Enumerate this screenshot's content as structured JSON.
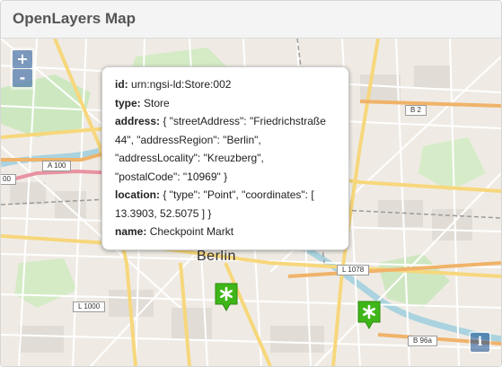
{
  "header": {
    "title": "OpenLayers Map"
  },
  "map": {
    "zoom_in_label": "+",
    "zoom_out_label": "-",
    "attribution_label": "i",
    "city_label": "Berlin",
    "road_labels": {
      "a100": "A 100",
      "b2": "B 2",
      "l1078": "L 1078",
      "l1000": "L 1000",
      "b96a": "B 96a",
      "edge_left": "00"
    },
    "markers": [
      {
        "icon": "asterisk-marker-icon",
        "color": "#3fb618"
      },
      {
        "icon": "asterisk-marker-icon",
        "color": "#3fb618"
      }
    ]
  },
  "popup": {
    "id_label": "id:",
    "id_value": "urn:ngsi-ld:Store:002",
    "type_label": "type:",
    "type_value": "Store",
    "address_label": "address:",
    "address_line1": "{ \"streetAddress\": \"Friedrichstraße",
    "address_line2": "44\", \"addressRegion\": \"Berlin\",",
    "address_line3": "\"addressLocality\": \"Kreuzberg\",",
    "address_line4": "\"postalCode\": \"10969\" }",
    "location_label": "location:",
    "location_line1": "{ \"type\": \"Point\", \"coordinates\": [",
    "location_line2": "13.3903, 52.5075 ] }",
    "name_label": "name:",
    "name_value": "Checkpoint Markt"
  }
}
